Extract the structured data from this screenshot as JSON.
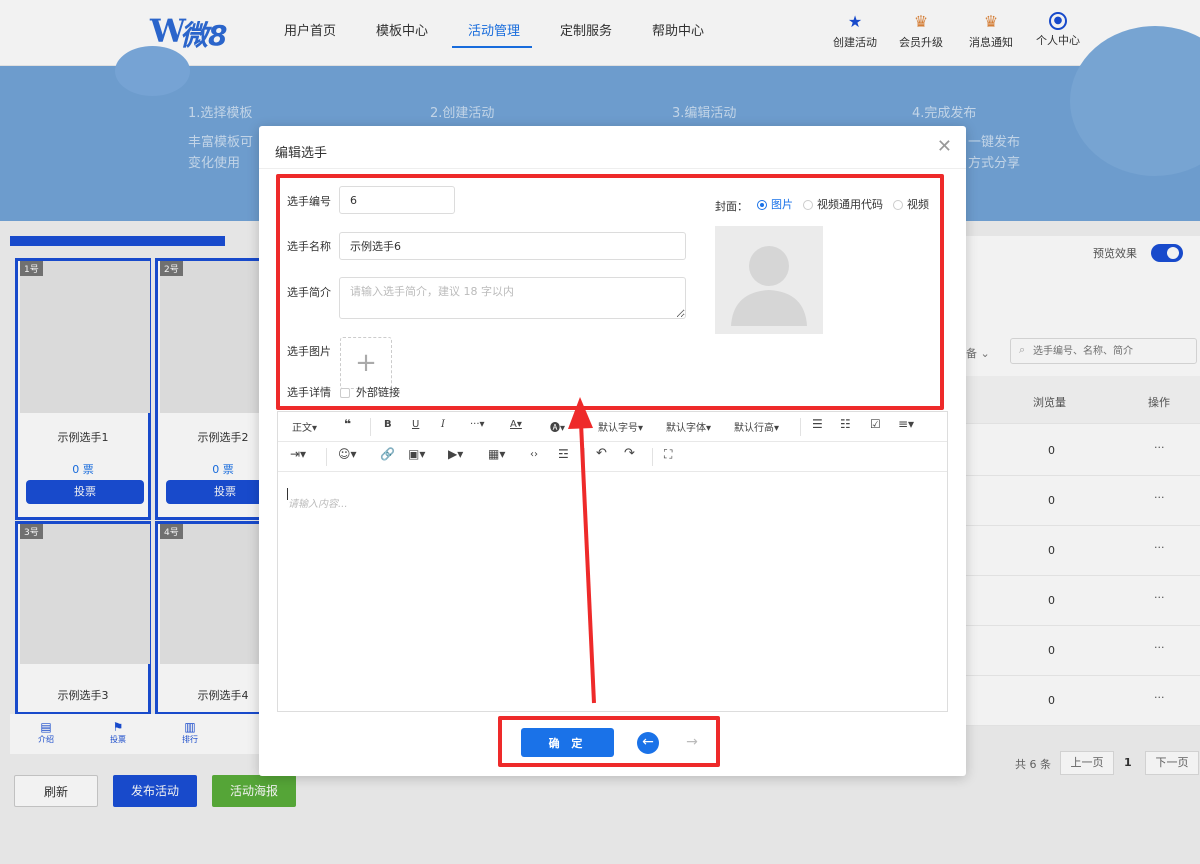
{
  "header": {
    "logo_mark": "W",
    "logo_text": "微8",
    "nav": [
      "用户首页",
      "模板中心",
      "活动管理",
      "定制服务",
      "帮助中心"
    ],
    "active_nav": "活动管理",
    "actions": [
      {
        "label": "创建活动",
        "icon": "star-icon"
      },
      {
        "label": "会员升级",
        "icon": "crown-icon"
      },
      {
        "label": "消息通知",
        "icon": "bell-icon"
      },
      {
        "label": "个人中心",
        "icon": "user-icon"
      }
    ]
  },
  "banner": {
    "steps": [
      {
        "title": "1.选择模板",
        "desc1": "丰富模板可",
        "desc2": "变化使用"
      },
      {
        "title": "2.创建活动"
      },
      {
        "title": "3.编辑活动"
      },
      {
        "title": "4.完成发布",
        "desc1": "一键发布",
        "desc2": "方式分享"
      }
    ]
  },
  "preview": {
    "cards": [
      {
        "num": "1号",
        "name": "示例选手1",
        "votes": "0 票",
        "button": "投票"
      },
      {
        "num": "2号",
        "name": "示例选手2",
        "votes": "0 票",
        "button": "投票"
      },
      {
        "num": "3号",
        "name": "示例选手3"
      },
      {
        "num": "4号",
        "name": "示例选手4"
      }
    ],
    "bottom_nav": [
      "介绍",
      "投票",
      "排行"
    ]
  },
  "page_buttons": {
    "refresh": "刷新",
    "publish": "发布活动",
    "poster": "活动海报"
  },
  "right_panel": {
    "preview_label": "预览效果",
    "filter_suffix": "备",
    "search_placeholder": "选手编号、名称、简介",
    "col_views": "浏览量",
    "col_ops": "操作",
    "rows": [
      {
        "views": "0",
        "ops": "···"
      },
      {
        "views": "0",
        "ops": "···"
      },
      {
        "views": "0",
        "ops": "···"
      },
      {
        "views": "0",
        "ops": "···"
      },
      {
        "views": "0",
        "ops": "···"
      },
      {
        "views": "0",
        "ops": "···"
      }
    ],
    "pagination": {
      "total": "共 6 条",
      "prev": "上一页",
      "current": "1",
      "next": "下一页"
    }
  },
  "modal": {
    "title": "编辑选手",
    "fields": {
      "number_label": "选手编号",
      "number_value": "6",
      "name_label": "选手名称",
      "name_value": "示例选手6",
      "intro_label": "选手简介",
      "intro_placeholder": "请输入选手简介，建议 18 字以内",
      "image_label": "选手图片",
      "detail_label": "选手详情",
      "external_link": "外部链接"
    },
    "cover": {
      "label": "封面：",
      "options": [
        "图片",
        "视频通用代码",
        "视频"
      ],
      "selected": "图片"
    },
    "toolbar": {
      "text_style": "正文",
      "font_size": "默认字号",
      "font_family": "默认字体",
      "line_height": "默认行高"
    },
    "editor_placeholder": "请输入内容...",
    "confirm": "确 定"
  },
  "colors": {
    "accent": "#1a72e8",
    "annotation": "#ee2a2a",
    "preview_blue": "#1a4fd6"
  }
}
